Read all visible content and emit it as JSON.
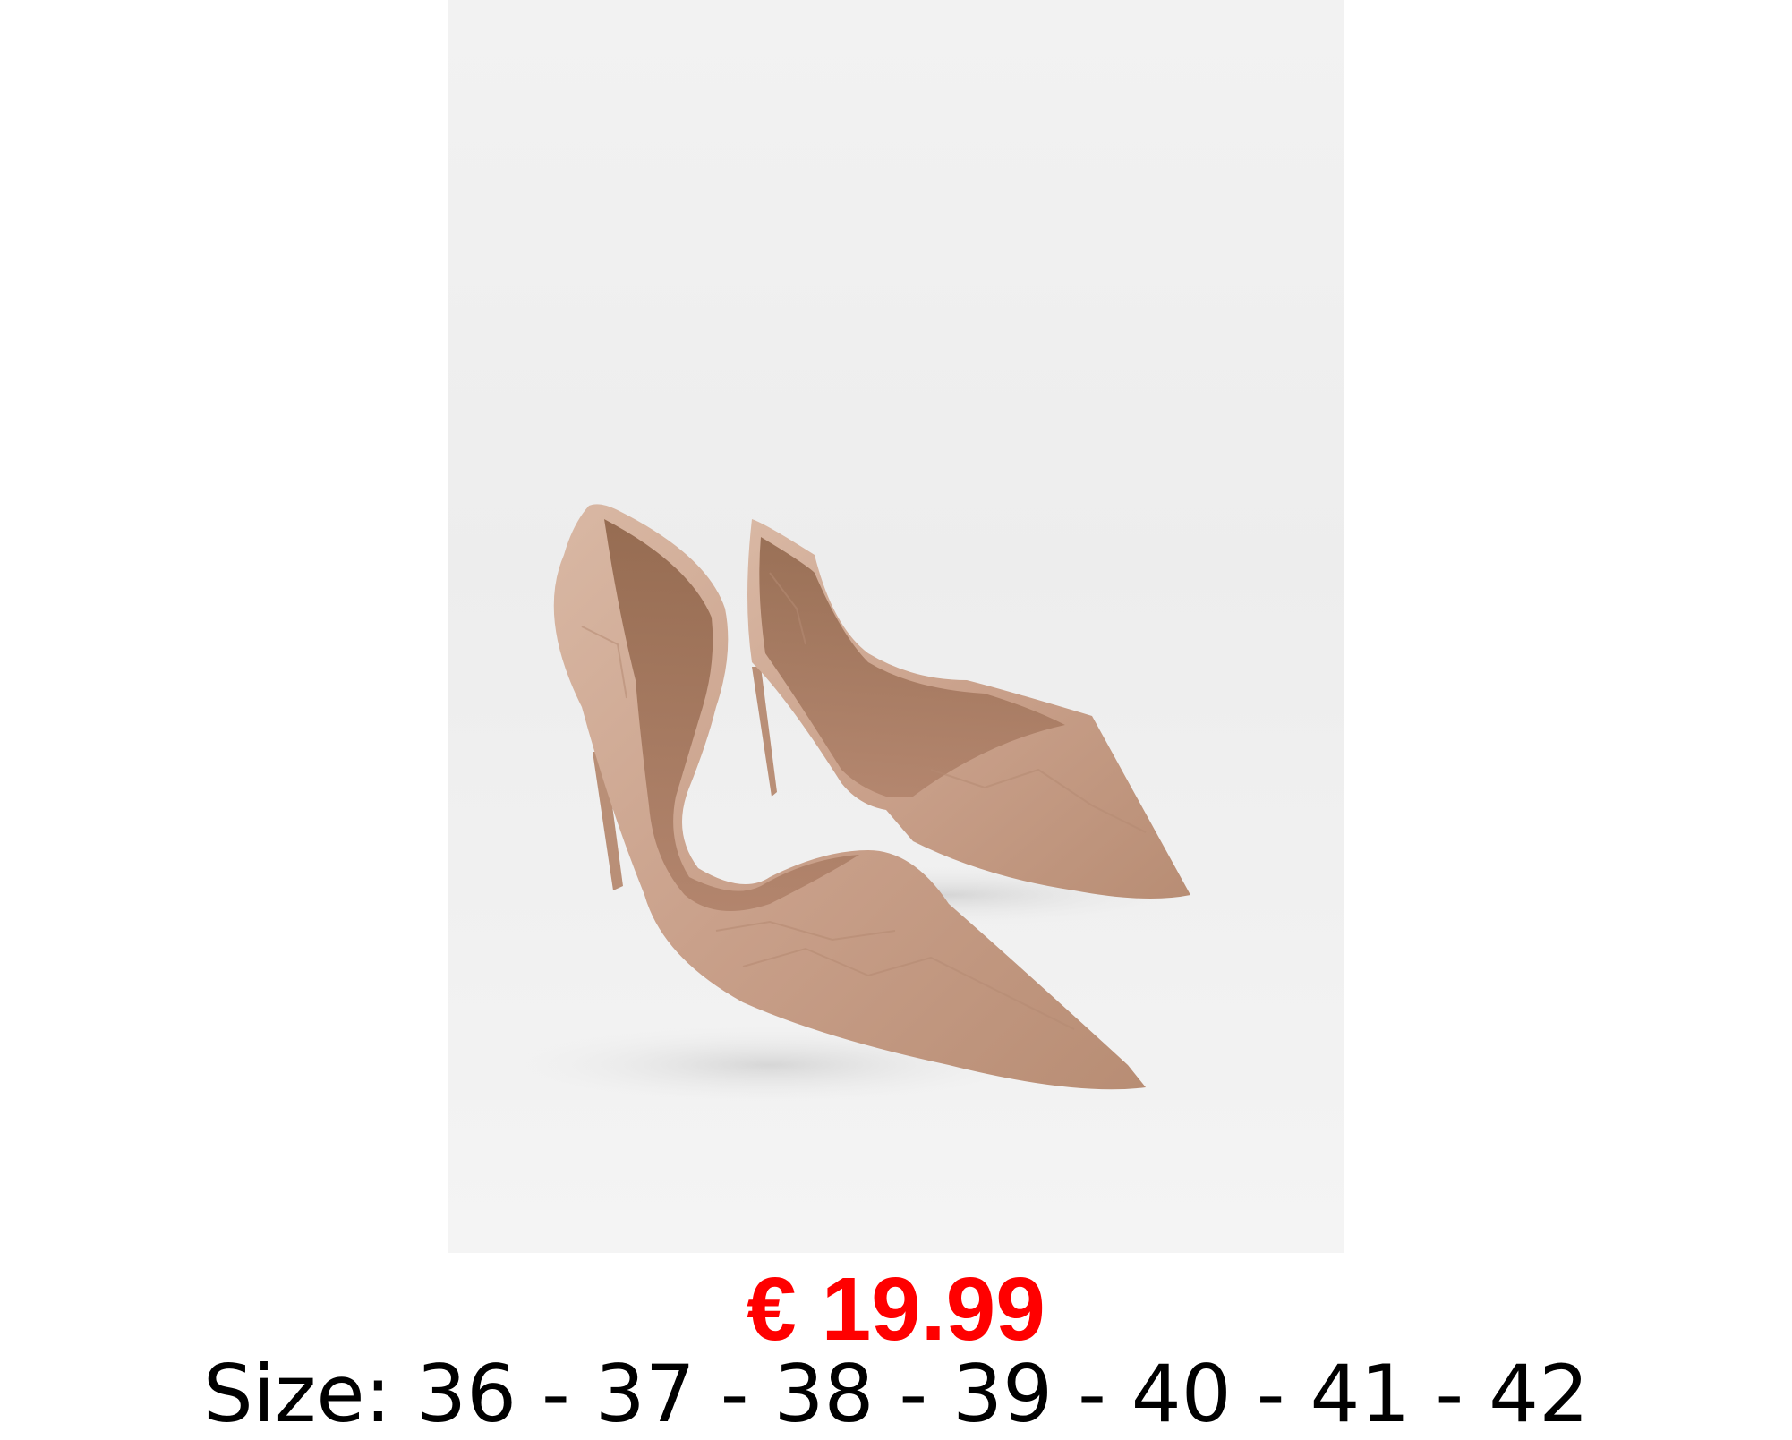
{
  "product": {
    "image_subject": "shoe-image",
    "price": "€ 19.99",
    "sizes": "Size: 36 - 37 - 38 - 39 - 40 - 41 - 42"
  },
  "colors": {
    "price": "#ff0000",
    "text": "#000000",
    "shoe": "#c9a08a",
    "shoe_inner": "#a97a5f"
  }
}
